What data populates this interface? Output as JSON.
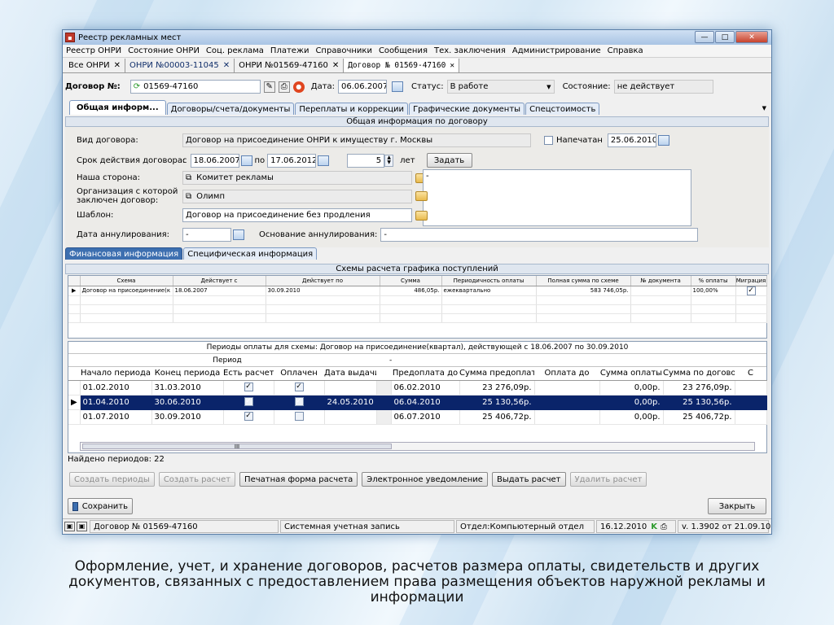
{
  "window": {
    "title": "Реестр рекламных мест"
  },
  "menu": [
    "Реестр ОНРИ",
    "Состояние ОНРИ",
    "Соц. реклама",
    "Платежи",
    "Справочники",
    "Сообщения",
    "Тех. заключения",
    "Администрирование",
    "Справка"
  ],
  "doc_tabs": [
    {
      "label": "Все ОНРИ"
    },
    {
      "label": "ОНРИ №00003-11045"
    },
    {
      "label": "ОНРИ №01569-47160"
    },
    {
      "label": "Договор № 01569-47160"
    }
  ],
  "contract": {
    "number_label": "Договор №:",
    "number": "01569-47160",
    "date_label": "Дата:",
    "date": "06.06.2007",
    "status_label": "Статус:",
    "status": "В работе",
    "state_label": "Состояние:",
    "state": "не действует"
  },
  "main_tabs": [
    "Общая информ...",
    "Договоры/счета/документы",
    "Переплаты и коррекции",
    "Графические документы",
    "Спецстоимость"
  ],
  "general": {
    "header": "Общая информация по договору",
    "type_label": "Вид договора:",
    "type": "Договор на присоединение ОНРИ к имуществу г. Москвы",
    "printed_label": "Напечатан",
    "printed_date": "25.06.2010",
    "term_label": "Срок действия договора:",
    "from_label": "с",
    "from": "18.06.2007",
    "to_label": "по",
    "to": "17.06.2012",
    "years": "5",
    "years_label": "лет",
    "set_button": "Задать",
    "our_side_label": "Наша сторона:",
    "our_side": "Комитет рекламы",
    "org_label": "Организация с которой заключен договор:",
    "org": "Олимп",
    "note": "-",
    "template_label": "Шаблон:",
    "template": "Договор на присоединение без продления",
    "cancel_date_label": "Дата аннулирования:",
    "cancel_date": "-",
    "cancel_reason_label": "Основание аннулирования:",
    "cancel_reason": "-"
  },
  "sub_tabs": [
    "Финансовая информация",
    "Специфическая информация"
  ],
  "schemes": {
    "header": "Схемы расчета графика поступлений",
    "columns": [
      "Схема",
      "Действует с",
      "Действует по",
      "Сумма",
      "Периодичность оплаты",
      "Полная сумма по схеме",
      "№ документа",
      "% оплаты",
      "Миграция"
    ],
    "rows": [
      {
        "scheme": "Договор на присоединение(к",
        "from": "18.06.2007",
        "to": "30.09.2010",
        "sum": "486,05р.",
        "period": "ежеквартально",
        "full": "583 746,05р.",
        "doc": "",
        "pct": "100,00%",
        "migr": "✓"
      }
    ]
  },
  "periods": {
    "header": "Периоды оплаты для схемы: Договор на присоединение(квартал), действующей с 18.06.2007 по 30.09.2010",
    "group_label": "Период",
    "group_dash": "-",
    "columns": [
      "Начало периода",
      "Конец периода",
      "Есть расчет",
      "Оплачен",
      "Дата выдачи",
      "",
      "Предоплата до",
      "Сумма предоплаты",
      "Оплата до",
      "Сумма оплаты",
      "Сумма по договору",
      "С"
    ],
    "rows": [
      {
        "start": "01.02.2010",
        "end": "31.03.2010",
        "calc": "✓",
        "paid": "✓",
        "issued": "",
        "prepay_to": "06.02.2010",
        "prepay_sum": "23 276,09р.",
        "pay_to": "",
        "pay_sum": "0,00р.",
        "contract_sum": "23 276,09р."
      },
      {
        "start": "01.04.2010",
        "end": "30.06.2010",
        "calc": "✓",
        "paid": "✓",
        "issued": "24.05.2010",
        "prepay_to": "06.04.2010",
        "prepay_sum": "25 130,56р.",
        "pay_to": "",
        "pay_sum": "0,00р.",
        "contract_sum": "25 130,56р."
      },
      {
        "start": "01.07.2010",
        "end": "30.09.2010",
        "calc": "✓",
        "paid": "",
        "issued": "",
        "prepay_to": "06.07.2010",
        "prepay_sum": "25 406,72р.",
        "pay_to": "",
        "pay_sum": "0,00р.",
        "contract_sum": "25 406,72р."
      }
    ],
    "found": "Найдено периодов: 22",
    "scroll_mark": "III"
  },
  "actions": {
    "create_periods": "Создать периоды",
    "create_calc": "Создать расчет",
    "print_form": "Печатная форма расчета",
    "e_notice": "Электронное уведомление",
    "issue_calc": "Выдать расчет",
    "delete_calc": "Удалить расчет"
  },
  "footer": {
    "save": "Сохранить",
    "close": "Закрыть"
  },
  "statusbar": {
    "doc": "Договор № 01569-47160",
    "account": "Системная учетная запись",
    "dept": "Отдел:Компьютерный отдел",
    "date": "16.12.2010",
    "k": "K",
    "version": "v. 1.3902 от 21.09.10"
  },
  "caption": "Оформление, учет, и хранение договоров, расчетов размера оплаты, свидетельств и других документов, связанных с предоставлением права размещения объектов наружной рекламы и информации"
}
